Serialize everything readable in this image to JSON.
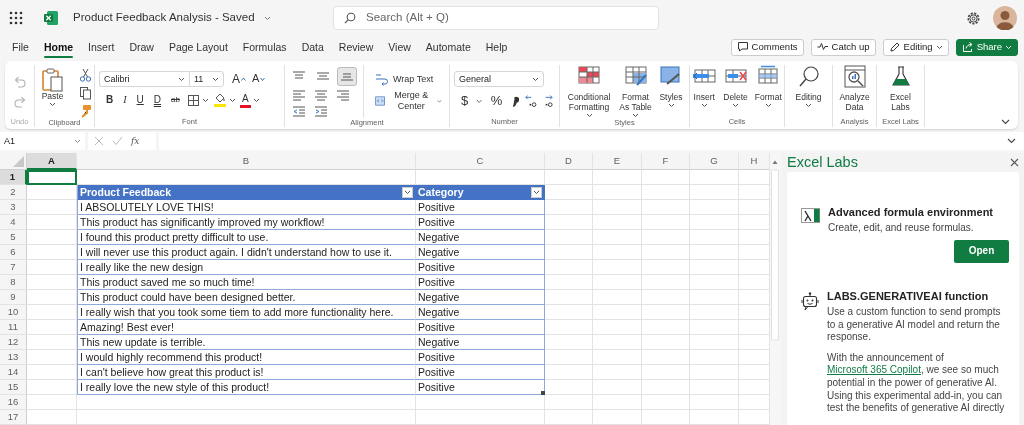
{
  "title_bar": {
    "document_title": "Product Feedback Analysis - Saved",
    "search": {
      "placeholder": "Search (Alt + Q)"
    }
  },
  "menu_tabs": [
    {
      "label": "File",
      "selected": false
    },
    {
      "label": "Home",
      "selected": true
    },
    {
      "label": "Insert",
      "selected": false
    },
    {
      "label": "Draw",
      "selected": false
    },
    {
      "label": "Page Layout",
      "selected": false
    },
    {
      "label": "Formulas",
      "selected": false
    },
    {
      "label": "Data",
      "selected": false
    },
    {
      "label": "Review",
      "selected": false
    },
    {
      "label": "View",
      "selected": false
    },
    {
      "label": "Automate",
      "selected": false
    },
    {
      "label": "Help",
      "selected": false
    }
  ],
  "actions": [
    {
      "kind": "comments",
      "label": "Comments"
    },
    {
      "kind": "catch_up",
      "label": "Catch up"
    },
    {
      "kind": "mode",
      "label": "Editing"
    },
    {
      "kind": "share",
      "label": "Share"
    }
  ],
  "ribbon": {
    "groups": [
      {
        "kind": "undo",
        "label": "Undo",
        "disabled": true
      },
      {
        "kind": "clipboard",
        "label": "Clipboard",
        "paste": "Paste"
      },
      {
        "kind": "font",
        "label": "Font",
        "font_name": "Calibri",
        "font_size": "11",
        "grow": "A",
        "shrink": "A",
        "styles": [
          {
            "kind": "bold",
            "label": "B"
          },
          {
            "kind": "italic",
            "label": "I"
          },
          {
            "kind": "underline",
            "label": "U"
          },
          {
            "kind": "double_underline",
            "label": "D"
          },
          {
            "kind": "strikethrough",
            "label": "ab"
          }
        ],
        "font_color_label": "A"
      },
      {
        "kind": "alignment",
        "label": "Alignment",
        "vertical": [
          {
            "kind": "top",
            "selected": false
          },
          {
            "kind": "middle",
            "selected": false
          },
          {
            "kind": "bottom",
            "selected": true
          }
        ],
        "wrap_text": "Wrap Text",
        "merge": "Merge & Center"
      },
      {
        "kind": "number",
        "label": "Number",
        "format": "General",
        "currency": "$",
        "percent": "%"
      },
      {
        "kind": "buttons",
        "label": "Styles",
        "buttons": [
          {
            "kind": "conditional",
            "label": "Conditional Formatting",
            "dropdown": true
          },
          {
            "kind": "table",
            "label": "Format As Table",
            "dropdown": true
          },
          {
            "kind": "styles",
            "label": "Styles",
            "dropdown": true
          }
        ]
      },
      {
        "kind": "buttons",
        "label": "Cells",
        "buttons": [
          {
            "kind": "insert",
            "label": "Insert",
            "dropdown": true
          },
          {
            "kind": "delete",
            "label": "Delete",
            "dropdown": true
          },
          {
            "kind": "format",
            "label": "Format",
            "dropdown": true
          }
        ]
      },
      {
        "kind": "buttons",
        "buttons": [
          {
            "kind": "find",
            "label": "Editing",
            "dropdown": true
          }
        ]
      },
      {
        "kind": "buttons",
        "label": "Analysis",
        "buttons": [
          {
            "kind": "analyze",
            "label": "Analyze Data",
            "dropdown": false
          }
        ]
      },
      {
        "kind": "buttons",
        "label": "Excel Labs",
        "buttons": [
          {
            "kind": "labs",
            "label": "Excel Labs",
            "dropdown": false
          }
        ]
      }
    ]
  },
  "formula_bar": {
    "name_box": "A1",
    "function_label": "fx"
  },
  "sheet": {
    "columns": [
      {
        "label": "A",
        "selected": true
      },
      {
        "label": "B",
        "selected": false
      },
      {
        "label": "C",
        "selected": false
      },
      {
        "label": "D",
        "selected": false
      },
      {
        "label": "E",
        "selected": false
      },
      {
        "label": "F",
        "selected": false
      },
      {
        "label": "G",
        "selected": false
      },
      {
        "label": "H",
        "selected": false
      }
    ],
    "rows": [
      {
        "label": "1",
        "selected": true
      },
      {
        "label": "2",
        "selected": false
      },
      {
        "label": "3",
        "selected": false
      },
      {
        "label": "4",
        "selected": false
      },
      {
        "label": "5",
        "selected": false
      },
      {
        "label": "6",
        "selected": false
      },
      {
        "label": "7",
        "selected": false
      },
      {
        "label": "8",
        "selected": false
      },
      {
        "label": "9",
        "selected": false
      },
      {
        "label": "10",
        "selected": false
      },
      {
        "label": "11",
        "selected": false
      },
      {
        "label": "12",
        "selected": false
      },
      {
        "label": "13",
        "selected": false
      },
      {
        "label": "14",
        "selected": false
      },
      {
        "label": "15",
        "selected": false
      },
      {
        "label": "16",
        "selected": false
      },
      {
        "label": "17",
        "selected": false
      }
    ],
    "table": {
      "columns": [
        "Product Feedback",
        "Category"
      ],
      "rows": [
        [
          "I ABSOLUTELY LOVE THIS!",
          "Positive"
        ],
        [
          "This product has significantly improved my workflow!",
          "Positive"
        ],
        [
          "I found this product pretty difficult to use.",
          "Negative"
        ],
        [
          "I will never use this product again. I didn't understand how to use it.",
          "Negative"
        ],
        [
          "I really like the new design",
          "Positive"
        ],
        [
          "This product saved me so much time!",
          "Positive"
        ],
        [
          "This product could have been designed better.",
          "Negative"
        ],
        [
          "I really wish that you took some tiem to add more functionality here.",
          "Negative"
        ],
        [
          "Amazing! Best ever!",
          "Positive"
        ],
        [
          "This new update is terrible.",
          "Negative"
        ],
        [
          "I would highly recommend this product!",
          "Positive"
        ],
        [
          "I can't believe how great this product is!",
          "Positive"
        ],
        [
          "I really love the new style of this product!",
          "Positive"
        ]
      ]
    }
  },
  "panel": {
    "title": "Excel Labs",
    "features": [
      {
        "kind": "formula",
        "title": "Advanced formula environment",
        "description": "Create, edit, and reuse formulas.",
        "button": "Open"
      },
      {
        "kind": "ai",
        "title": "LABS.GENERATIVEAI function",
        "description": "Use a custom function to send prompts to a generative AI model and return the response.",
        "note": {
          "before": "With the announcement of ",
          "link": "Microsoft 365 Copilot",
          "after": ", we see so much potential in the power of generative AI. Using this experimental add-in, you can test the benefits of generative AI directly"
        }
      }
    ]
  }
}
